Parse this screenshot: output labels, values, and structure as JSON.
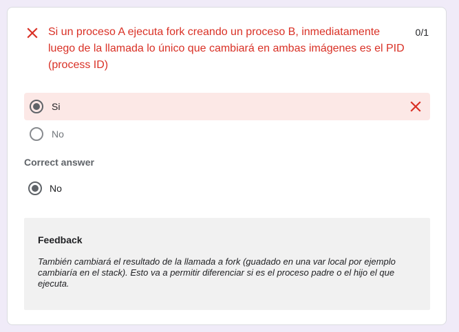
{
  "question": {
    "title": "Si un proceso A ejecuta fork creando un proceso B, inmediatamente luego de la llamada lo único que cambiará en ambas imágenes es el PID (process ID)",
    "score": "0/1",
    "status_icon": "close-icon",
    "colors": {
      "error": "#d93025",
      "error_bg": "#fce8e6"
    }
  },
  "options": [
    {
      "label": "Si",
      "selected": true,
      "result": "incorrect"
    },
    {
      "label": "No",
      "selected": false
    }
  ],
  "correct": {
    "heading": "Correct answer",
    "answer": "No"
  },
  "feedback": {
    "heading": "Feedback",
    "text": "También cambiará el resultado de la llamada a fork (guadado en una var local por ejemplo cambiaría en el stack). Esto va a permitir diferenciar si es el proceso padre o el hijo el que ejecuta."
  }
}
